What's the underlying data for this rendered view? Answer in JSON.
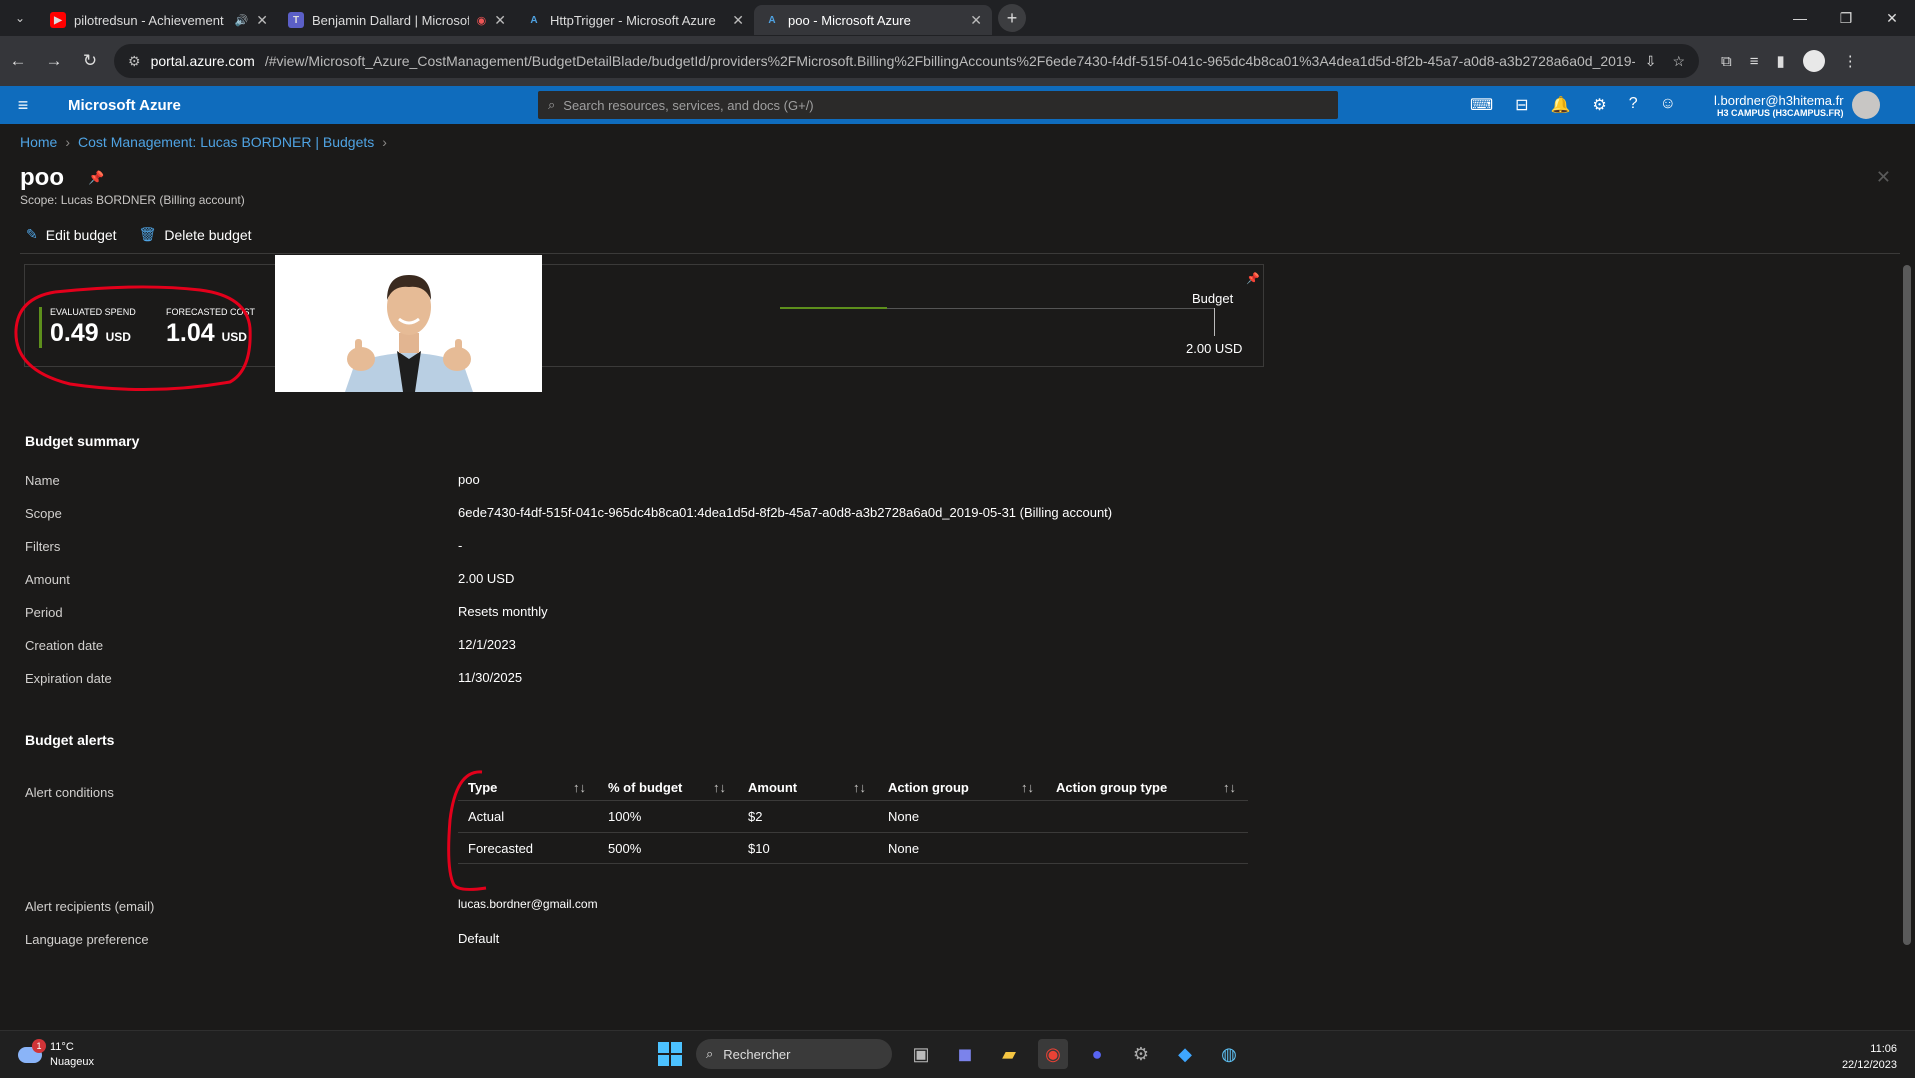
{
  "browser": {
    "tabs": [
      {
        "title": "pilotredsun - Achievement",
        "icon_color": "#ff0000",
        "active": false
      },
      {
        "title": "Benjamin Dallard | Microsof",
        "icon_color": "#5b5fc7",
        "active": false
      },
      {
        "title": "HttpTrigger - Microsoft Azure",
        "icon_color": "#0f6cbd",
        "active": false
      },
      {
        "title": "poo - Microsoft Azure",
        "icon_color": "#0f6cbd",
        "active": true
      }
    ],
    "url_host": "portal.azure.com",
    "url_path": "/#view/Microsoft_Azure_CostManagement/BudgetDetailBlade/budgetId/providers%2FMicrosoft.Billing%2FbillingAccounts%2F6ede7430-f4df-515f-041c-965dc4b8ca01%3A4dea1d5d-8f2b-45a7-a0d8-a3b2728a6a0d_2019-..."
  },
  "azure": {
    "brand": "Microsoft Azure",
    "search_placeholder": "Search resources, services, and docs (G+/)",
    "user": "l.bordner@h3hitema.fr",
    "tenant": "H3 CAMPUS (H3CAMPUS.FR)"
  },
  "breadcrumb": [
    "Home",
    "Cost Management: Lucas BORDNER | Budgets"
  ],
  "page": {
    "title": "poo",
    "scope": "Scope: Lucas BORDNER (Billing account)"
  },
  "toolbar": {
    "edit": "Edit budget",
    "delete": "Delete budget"
  },
  "overview": {
    "evaluated_label": "EVALUATED SPEND",
    "evaluated_value": "0.49",
    "forecasted_label": "FORECASTED COST",
    "forecasted_value": "1.04",
    "currency": "USD",
    "budget_label": "Budget",
    "budget_value": "2.00 USD",
    "spend_fraction": 0.245
  },
  "summary": {
    "heading": "Budget summary",
    "rows": [
      {
        "label": "Name",
        "value": "poo"
      },
      {
        "label": "Scope",
        "value": "6ede7430-f4df-515f-041c-965dc4b8ca01:4dea1d5d-8f2b-45a7-a0d8-a3b2728a6a0d_2019-05-31 (Billing account)"
      },
      {
        "label": "Filters",
        "value": "-"
      },
      {
        "label": "Amount",
        "value": "2.00 USD"
      },
      {
        "label": "Period",
        "value": "Resets monthly"
      },
      {
        "label": "Creation date",
        "value": "12/1/2023"
      },
      {
        "label": "Expiration date",
        "value": "11/30/2025"
      }
    ]
  },
  "alerts": {
    "heading": "Budget alerts",
    "conditions_label": "Alert conditions",
    "columns": [
      "Type",
      "% of budget",
      "Amount",
      "Action group",
      "Action group type"
    ],
    "rows": [
      [
        "Actual",
        "100%",
        "$2",
        "None",
        ""
      ],
      [
        "Forecasted",
        "500%",
        "$10",
        "None",
        ""
      ]
    ],
    "recipients_label": "Alert recipients (email)",
    "recipients_value": "lucas.bordner@gmail.com",
    "language_label": "Language preference",
    "language_value": "Default"
  },
  "taskbar": {
    "temp": "11°C",
    "weather": "Nuageux",
    "weather_badge": "1",
    "search": "Rechercher",
    "time": "11:06",
    "date": "22/12/2023"
  },
  "colors": {
    "accent": "#0f6cbd",
    "annotation": "#e3001b",
    "spend_bar": "#5d8f1c"
  }
}
